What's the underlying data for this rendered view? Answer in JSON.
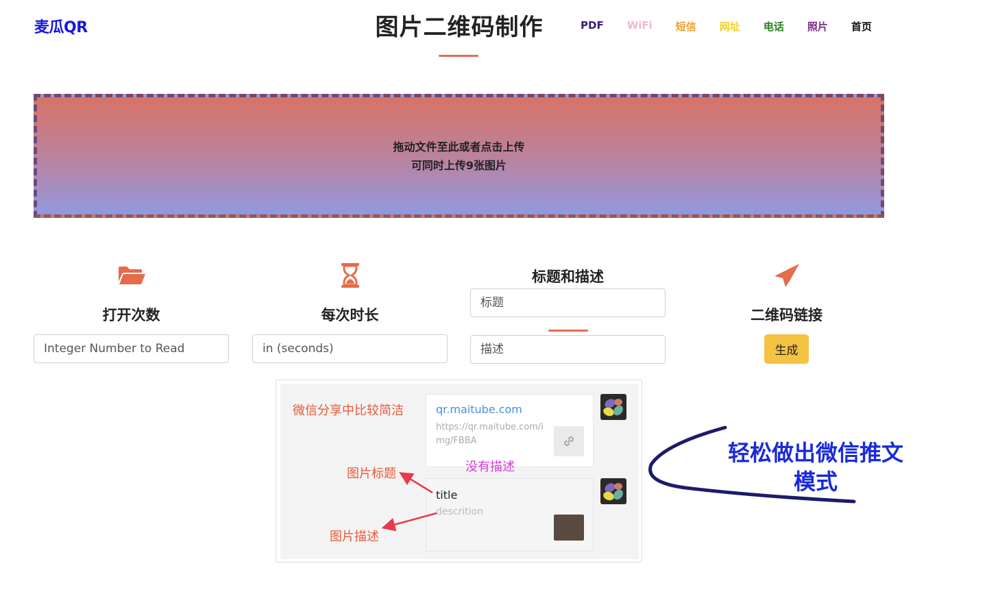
{
  "header": {
    "logo": "麦瓜QR",
    "title": "图片二维码制作",
    "nav": [
      "PDF",
      "WiFi",
      "短信",
      "网址",
      "电话",
      "照片",
      "首页"
    ]
  },
  "dropzone": {
    "line1": "拖动文件至此或者点击上传",
    "line2": "可同时上传9张图片"
  },
  "features": {
    "open_count": {
      "label": "打开次数",
      "placeholder": "Integer Number to Read",
      "icon": "folder-open-icon"
    },
    "duration": {
      "label": "每次时长",
      "placeholder": "in (seconds)",
      "icon": "hourglass-icon"
    },
    "title_desc": {
      "label": "标题和描述",
      "title_placeholder": "标题",
      "desc_placeholder": "描述"
    },
    "qr_link": {
      "label": "二维码链接",
      "button": "生成",
      "icon": "paper-plane-icon"
    }
  },
  "demo": {
    "note_clean": "微信分享中比较简洁",
    "card1_title": "qr.maitube.com",
    "card1_url": "https://qr.maitube.com/img/FBBA",
    "note_no_desc": "没有描述",
    "note_img_title": "图片标题",
    "note_img_desc": "图片描述",
    "card2_title": "title",
    "card2_desc": "descrition"
  },
  "annotation": {
    "line1": "轻松做出微信推文",
    "line2": "模式"
  },
  "colors": {
    "accent": "#e56b4a",
    "logo": "#1418e0",
    "button": "#f5c242",
    "annotation": "#1a2bd8"
  }
}
